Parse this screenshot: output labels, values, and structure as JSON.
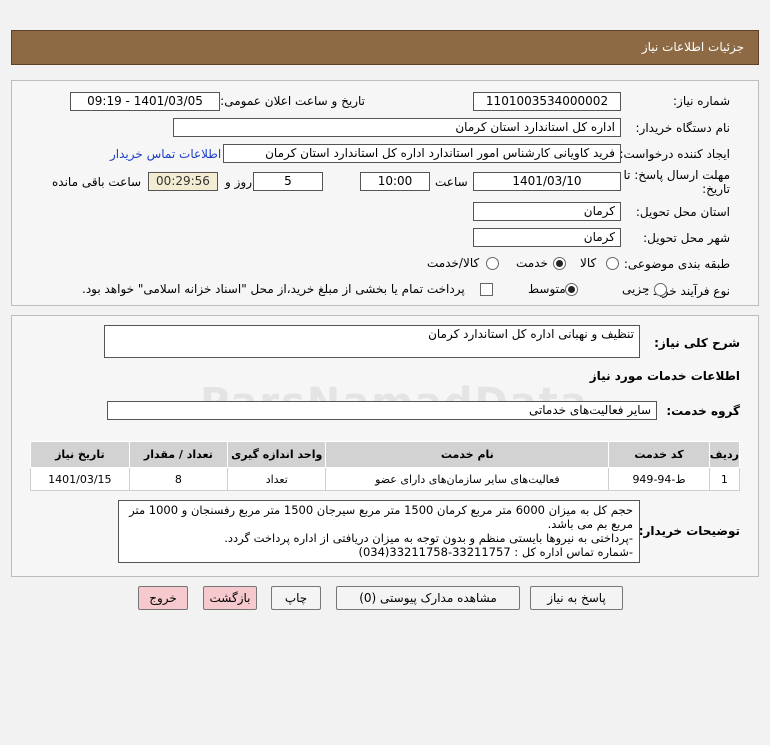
{
  "header": {
    "title": "جزئیات اطلاعات نیاز"
  },
  "fields": {
    "need_number_label": "شماره نیاز:",
    "need_number": "1101003534000002",
    "announce_label": "تاریخ و ساعت اعلان عمومی:",
    "announce_value": "1401/03/05 - 09:19",
    "buyer_org_label": "نام دستگاه خریدار:",
    "buyer_org": "اداره کل استاندارد استان کرمان",
    "creator_label": "ایجاد کننده درخواست:",
    "creator": "فرید کاویانی کارشناس امور استاندارد اداره کل استاندارد استان کرمان",
    "contact_link": "اطلاعات تماس خریدار",
    "deadline_label_1": "مهلت ارسال پاسخ: تا",
    "deadline_label_2": "تاریخ:",
    "deadline_date": "1401/03/10",
    "time_label": "ساعت",
    "deadline_time": "10:00",
    "days_value": "5",
    "days_label": "روز و",
    "remaining_time": "00:29:56",
    "remaining_label": "ساعت باقی مانده",
    "province_label": "استان محل تحویل:",
    "province": "کرمان",
    "city_label": "شهر محل تحویل:",
    "city": "کرمان",
    "category_label": "طبقه بندی موضوعی:",
    "category_options": [
      "کالا",
      "خدمت",
      "کالا/خدمت"
    ],
    "category_selected": "خدمت",
    "process_label": "نوع فرآیند خرید :",
    "process_options": [
      "جزیی",
      "متوسط"
    ],
    "process_selected": "متوسط",
    "payment_note": "پرداخت تمام یا بخشی از مبلغ خرید،از محل \"اسناد خزانه اسلامی\" خواهد بود."
  },
  "summary": {
    "label": "شرح کلی نیاز:",
    "value": "تنظیف و نهبانی اداره کل استاندارد کرمان"
  },
  "services_heading": "اطلاعات خدمات مورد نیاز",
  "service_group": {
    "label": "گروه خدمت:",
    "value": "سایر فعالیت‌های خدماتی"
  },
  "table": {
    "headers": [
      "ردیف",
      "کد خدمت",
      "نام خدمت",
      "واحد اندازه گیری",
      "تعداد / مقدار",
      "تاریخ نیاز"
    ],
    "rows": [
      [
        "1",
        "ط-94-949",
        "فعالیت‌های سایر سازمان‌های دارای عضو",
        "تعداد",
        "8",
        "1401/03/15"
      ]
    ]
  },
  "buyer_notes": {
    "label": "توضیحات خریدار:",
    "lines": [
      "حجم کل به میزان 6000 متر مربع کرمان 1500 متر مربع سیرجان 1500 متر مربع رفسنجان و 1000 متر",
      "مربع بم می باشد.",
      "-پرداختی به نیروها بایستی منظم و بدون توجه به میزان دریافتی از اداره پرداخت گردد.",
      "-شماره تماس اداره کل : 33211757-33211758(034)"
    ]
  },
  "buttons": {
    "reply": "پاسخ به نیاز",
    "attachments": "مشاهده مدارک پیوستی (0)",
    "print": "چاپ",
    "back": "بازگشت",
    "exit": "خروج"
  },
  "watermark": "ParsNamadData"
}
